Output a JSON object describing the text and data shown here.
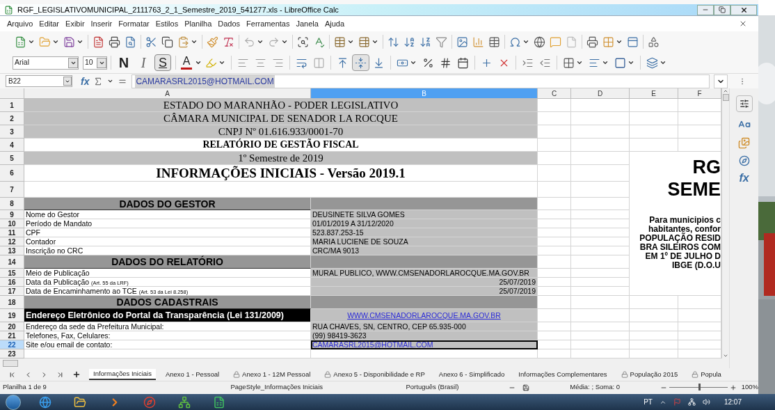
{
  "window": {
    "title": "RGF_LEGISLATIVOMUNICIPAL_2111763_2_1_Semestre_2019_541277.xls - LibreOffice Calc"
  },
  "menu": [
    "Arquivo",
    "Editar",
    "Exibir",
    "Inserir",
    "Formatar",
    "Estilos",
    "Planilha",
    "Dados",
    "Ferramentas",
    "Janela",
    "Ajuda"
  ],
  "format_bar": {
    "font": "Arial",
    "size": "10",
    "style_buttons": [
      {
        "label": "N",
        "kind": "bold",
        "selected": false
      },
      {
        "label": "I",
        "kind": "italic",
        "selected": false
      },
      {
        "label": "S",
        "kind": "underline",
        "selected": true
      }
    ],
    "font_color_label": "A"
  },
  "formula_bar": {
    "cell": "B22",
    "function_label": "fx",
    "content": "CAMARASRL2015@HOTMAIL.COM"
  },
  "sidebar": {
    "functions_label": "fx"
  },
  "columns": [
    {
      "label": "A",
      "selected": false
    },
    {
      "label": "B",
      "selected": true
    },
    {
      "label": "C",
      "selected": false
    },
    {
      "label": "D",
      "selected": false
    },
    {
      "label": "E",
      "selected": false
    },
    {
      "label": "F",
      "selected": false
    }
  ],
  "rows": [
    {
      "n": "1",
      "kind": "title",
      "shaded": true,
      "selected": false,
      "a": "ESTADO DO MARANHÃO - PODER LEGISLATIVO"
    },
    {
      "n": "2",
      "kind": "title",
      "shaded": true,
      "selected": false,
      "a": "CÂMARA MUNICIPAL DE SENADOR LA ROCQUE"
    },
    {
      "n": "3",
      "kind": "title",
      "shaded": true,
      "selected": false,
      "a": "CNPJ Nº 01.616.933/0001-70"
    },
    {
      "n": "4",
      "kind": "title_bold",
      "shaded": false,
      "selected": false,
      "a": "RELATÓRIO DE GESTÃO FISCAL"
    },
    {
      "n": "5",
      "kind": "title",
      "shaded": true,
      "selected": false,
      "a": "1º Semestre de 2019"
    },
    {
      "n": "6",
      "kind": "title_large",
      "shaded": false,
      "selected": false,
      "a": "INFORMAÇÕES INICIAIS - Versão 2019.1"
    },
    {
      "n": "7",
      "kind": "blank_title",
      "selected": false
    },
    {
      "n": "8",
      "kind": "section",
      "selected": false,
      "a": "DADOS DO GESTOR"
    },
    {
      "n": "9",
      "kind": "field",
      "selected": false,
      "a": "Nome do Gestor",
      "b": "DEUSINETE SILVA GOMES"
    },
    {
      "n": "10",
      "kind": "field",
      "selected": false,
      "a": "Período de Mandato",
      "b": "01/01/2019 A 31/12/2020"
    },
    {
      "n": "11",
      "kind": "field",
      "selected": false,
      "a": "CPF",
      "b": "523.837.253-15"
    },
    {
      "n": "12",
      "kind": "field",
      "selected": false,
      "a": "Contador",
      "b": "MARIA LUCIENE DE SOUZA"
    },
    {
      "n": "13",
      "kind": "field",
      "selected": false,
      "a": "Inscrição no CRC",
      "b": "CRC/MA 9013"
    },
    {
      "n": "14",
      "kind": "section",
      "selected": false,
      "a": "DADOS DO RELATÓRIO"
    },
    {
      "n": "15",
      "kind": "field",
      "selected": false,
      "a": "Meio de Publicação",
      "b": "MURAL PUBLICO, WWW.CMSENADORLAROCQUE.MA.GOV.BR"
    },
    {
      "n": "16",
      "kind": "date_field",
      "selected": false,
      "a": "Data da Publicação",
      "a_note": "(Art. 55 da LRF)",
      "b": "25/07/2019"
    },
    {
      "n": "17",
      "kind": "date_field",
      "selected": false,
      "a": "Data de Encaminhamento ao TCE",
      "a_note": "(Art. 53 da Lei 8.258)",
      "b": "25/07/2019"
    },
    {
      "n": "18",
      "kind": "section",
      "selected": false,
      "a": "DADOS CADASTRAIS"
    },
    {
      "n": "19",
      "kind": "banner",
      "selected": false,
      "a": "Endereço Eletrônico do Portal da Transparência (Lei 131/2009)",
      "b": "WWW.CMSENADORLAROCQUE.MA.GOV.BR"
    },
    {
      "n": "20",
      "kind": "field",
      "selected": false,
      "a": "Endereço da sede da Prefeitura Municipal:",
      "b": "RUA CHAVES, SN, CENTRO, CEP 65.935-000"
    },
    {
      "n": "21",
      "kind": "field",
      "selected": false,
      "a": "Telefones, Fax, Celulares:",
      "b": "(99) 98419-3623"
    },
    {
      "n": "22",
      "kind": "link_field",
      "selected": true,
      "a": "Site e/ou email de contato:",
      "b": "CAMARASRL2015@HOTMAIL.COM"
    },
    {
      "n": "23",
      "kind": "blank",
      "selected": false
    }
  ],
  "side_note": {
    "title_lines": [
      "RG",
      "SEME"
    ],
    "lines": [
      "Para municipios c",
      "habitantes, confor",
      "POPULAÇÃO RESID",
      "BRA SILEIROS COM",
      "EM 1º DE JULHO D",
      "IBGE (D.O.U"
    ]
  },
  "sheet_tabs": [
    {
      "label": "Informações Iniciais",
      "selected": true,
      "locked": false
    },
    {
      "label": "Anexo 1 - Pessoal",
      "selected": false,
      "locked": false
    },
    {
      "label": "Anexo 1 - 12M Pessoal",
      "selected": false,
      "locked": true
    },
    {
      "label": "Anexo 5 - Disponibilidade e RP",
      "selected": false,
      "locked": true
    },
    {
      "label": "Anexo 6 - Simplificado",
      "selected": false,
      "locked": false
    },
    {
      "label": "Informações Complementares",
      "selected": false,
      "locked": false
    },
    {
      "label": "População 2015",
      "selected": false,
      "locked": true
    },
    {
      "label": "Popula",
      "selected": false,
      "locked": true
    }
  ],
  "status_bar": {
    "sheet": "Planilha 1 de 9",
    "page_style": "PageStyle_Informações Iniciais",
    "language": "Português (Brasil)",
    "summary": "Média: ; Soma: 0",
    "zoom": {
      "level": 0.5,
      "reading": "100%"
    }
  },
  "taskbar": {
    "language": "PT",
    "time": "12:07"
  }
}
